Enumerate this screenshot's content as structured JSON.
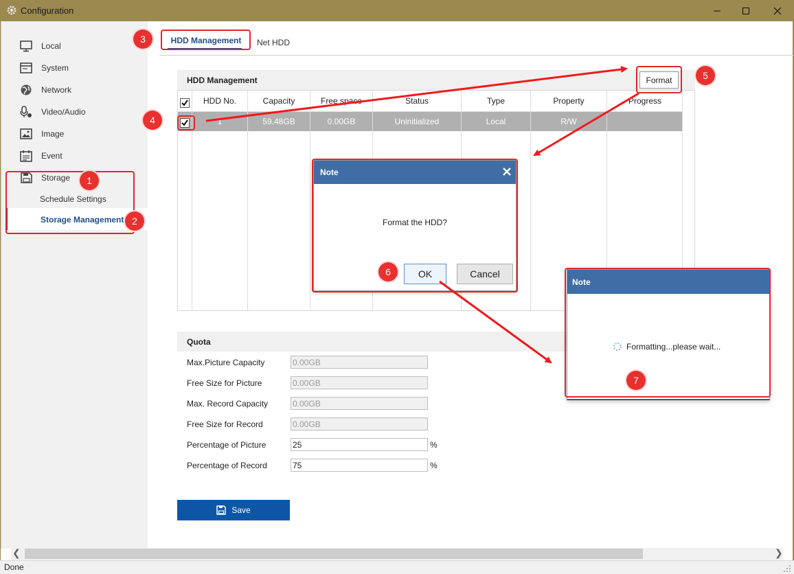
{
  "window": {
    "title": "Configuration"
  },
  "sidebar": {
    "items": [
      {
        "label": "Local",
        "icon": "monitor-icon"
      },
      {
        "label": "System",
        "icon": "system-window-icon"
      },
      {
        "label": "Network",
        "icon": "globe-icon"
      },
      {
        "label": "Video/Audio",
        "icon": "microphone-camera-icon"
      },
      {
        "label": "Image",
        "icon": "image-icon"
      },
      {
        "label": "Event",
        "icon": "calendar-icon"
      },
      {
        "label": "Storage",
        "icon": "floppy-disk-icon"
      }
    ],
    "storage_sub": [
      "Schedule Settings",
      "Storage Management"
    ]
  },
  "tabs": [
    "HDD Management",
    "Net HDD"
  ],
  "hdd_section": {
    "title": "HDD Management",
    "format_label": "Format",
    "columns": [
      "HDD No.",
      "Capacity",
      "Free space",
      "Status",
      "Type",
      "Property",
      "Progress"
    ],
    "rows": [
      {
        "no": "1",
        "capacity": "59.48GB",
        "free": "0.00GB",
        "status": "Uninitialized",
        "type": "Local",
        "property": "R/W",
        "progress": ""
      }
    ]
  },
  "dialog_note": {
    "title": "Note",
    "message": "Format the HDD?",
    "ok_label": "OK",
    "cancel_label": "Cancel"
  },
  "dialog_progress": {
    "title": "Note",
    "message": "Formatting...please wait..."
  },
  "quota": {
    "title": "Quota",
    "fields": [
      {
        "label": "Max.Picture Capacity",
        "value": "0.00GB",
        "readonly": true
      },
      {
        "label": "Free Size for Picture",
        "value": "0.00GB",
        "readonly": true
      },
      {
        "label": "Max. Record Capacity",
        "value": "0.00GB",
        "readonly": true
      },
      {
        "label": "Free Size for Record",
        "value": "0.00GB",
        "readonly": true
      },
      {
        "label": "Percentage of Picture",
        "value": "25",
        "unit": "%"
      },
      {
        "label": "Percentage of Record",
        "value": "75",
        "unit": "%"
      }
    ]
  },
  "save_label": "Save",
  "status_text": "Done",
  "annotations": [
    "1",
    "2",
    "3",
    "4",
    "5",
    "6",
    "7"
  ],
  "colors": {
    "accent": "#1e4f8c",
    "dialog_header": "#3f6ea6",
    "annotation": "#e5252a",
    "titlebar": "#9b8950"
  }
}
